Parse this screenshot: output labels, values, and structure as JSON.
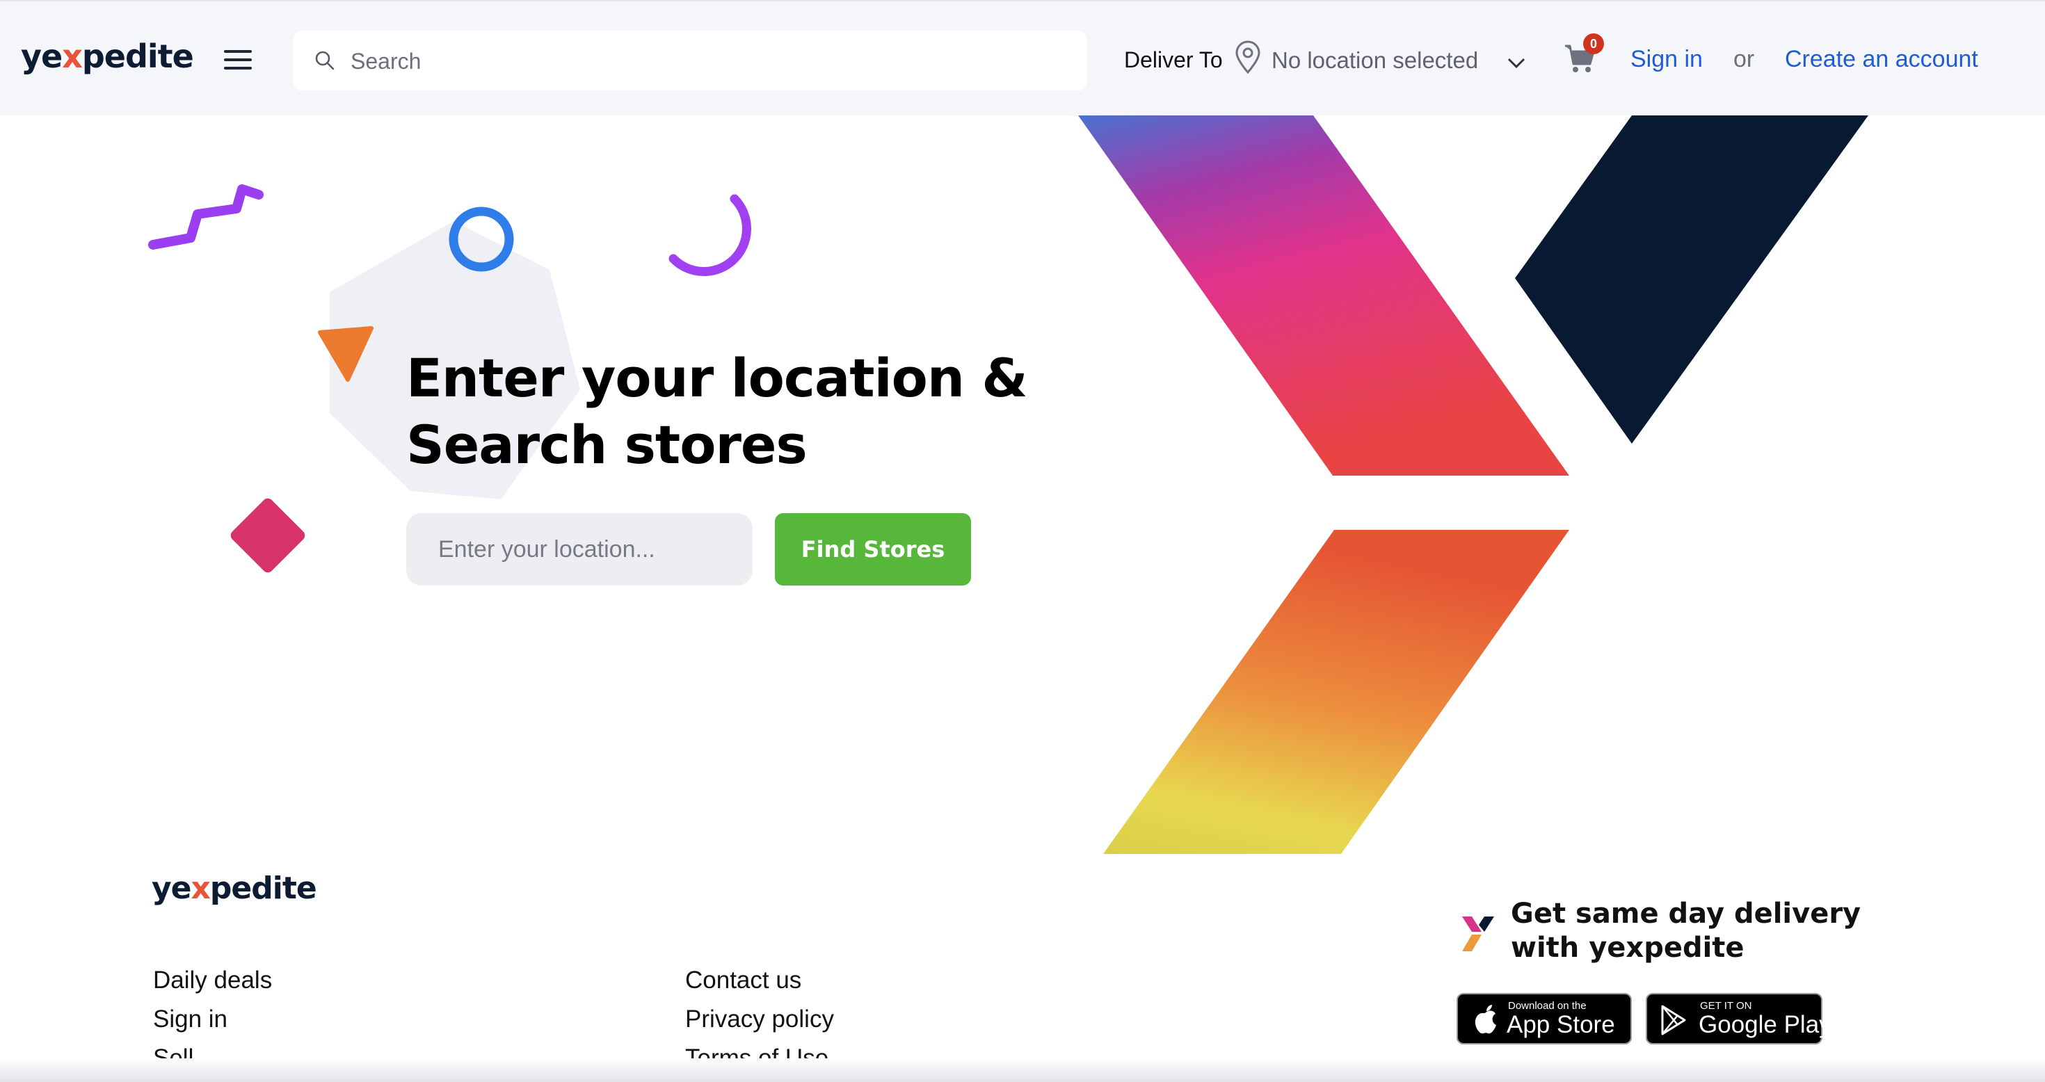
{
  "header": {
    "brand": {
      "pre": "ye",
      "x": "x",
      "post": "pedite"
    },
    "menu_icon": "hamburger-menu-icon",
    "search": {
      "placeholder": "Search",
      "icon": "search-icon"
    },
    "deliver_to_label": "Deliver To",
    "location": {
      "value": "No location selected",
      "icon": "map-pin-icon",
      "caret": "chevron-down-icon"
    },
    "cart": {
      "icon": "cart-icon",
      "count": "0"
    },
    "sign_in": "Sign in",
    "or": "or",
    "create_account": "Create an account"
  },
  "hero": {
    "title_line1": "Enter your location &",
    "title_line2": "Search stores",
    "location_input_placeholder": "Enter your location...",
    "find_button": "Find Stores"
  },
  "footer": {
    "brand": {
      "pre": "ye",
      "x": "x",
      "post": "pedite"
    },
    "links_col1": [
      "Daily deals",
      "Sign in",
      "Sell"
    ],
    "links_col2": [
      "Contact us",
      "Privacy policy",
      "Terms of Use"
    ],
    "app_promo_line1": "Get same day delivery",
    "app_promo_line2": "with yexpedite",
    "app_store": {
      "small": "Download on the",
      "big": "App Store",
      "icon": "apple-icon"
    },
    "google_play": {
      "small": "GET IT ON",
      "big": "Google Play",
      "icon": "play-store-icon"
    }
  },
  "colors": {
    "accent_link": "#1f5cd6",
    "find_button": "#56b73a",
    "badge": "#d0341f",
    "brand_navy": "#071a31"
  }
}
